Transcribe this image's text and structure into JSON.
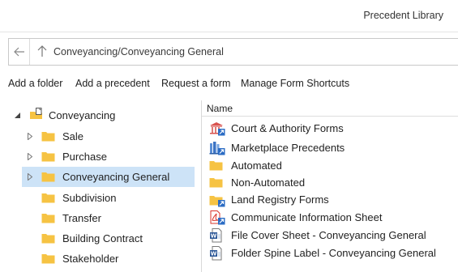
{
  "window": {
    "title": "Precedent Library"
  },
  "address_bar": {
    "path": "Conveyancing/Conveyancing General",
    "back_icon": "arrow-left-icon",
    "up_icon": "arrow-up-icon"
  },
  "toolbar": {
    "add_folder": "Add a folder",
    "add_precedent": "Add a precedent",
    "request_form": "Request a form",
    "manage_shortcuts": "Manage Form Shortcuts"
  },
  "tree": {
    "root": {
      "label": "Conveyancing",
      "icon": "folder-document-icon",
      "expanded": true
    },
    "children": [
      {
        "label": "Sale",
        "has_children": true,
        "selected": false
      },
      {
        "label": "Purchase",
        "has_children": true,
        "selected": false
      },
      {
        "label": "Conveyancing General",
        "has_children": true,
        "selected": true
      },
      {
        "label": "Subdivision",
        "has_children": false,
        "selected": false
      },
      {
        "label": "Transfer",
        "has_children": false,
        "selected": false
      },
      {
        "label": "Building Contract",
        "has_children": false,
        "selected": false
      },
      {
        "label": "Stakeholder",
        "has_children": false,
        "selected": false
      }
    ]
  },
  "list": {
    "column_name": "Name",
    "items": [
      {
        "label": "Court & Authority Forms",
        "icon": "court-shortcut-icon"
      },
      {
        "label": "Marketplace Precedents",
        "icon": "marketplace-shortcut-icon"
      },
      {
        "label": "Automated",
        "icon": "folder-icon"
      },
      {
        "label": "Non-Automated",
        "icon": "folder-icon"
      },
      {
        "label": "Land Registry Forms",
        "icon": "folder-shortcut-icon"
      },
      {
        "label": "Communicate Information Sheet",
        "icon": "pdf-shortcut-icon"
      },
      {
        "label": "File Cover Sheet - Conveyancing General",
        "icon": "word-document-icon"
      },
      {
        "label": "Folder Spine Label - Conveyancing General",
        "icon": "word-document-icon"
      }
    ]
  },
  "colors": {
    "folder": "#f6c343",
    "selection": "#cde3f7",
    "accent_blue": "#2b6cc4",
    "pdf_red": "#d9342b"
  }
}
